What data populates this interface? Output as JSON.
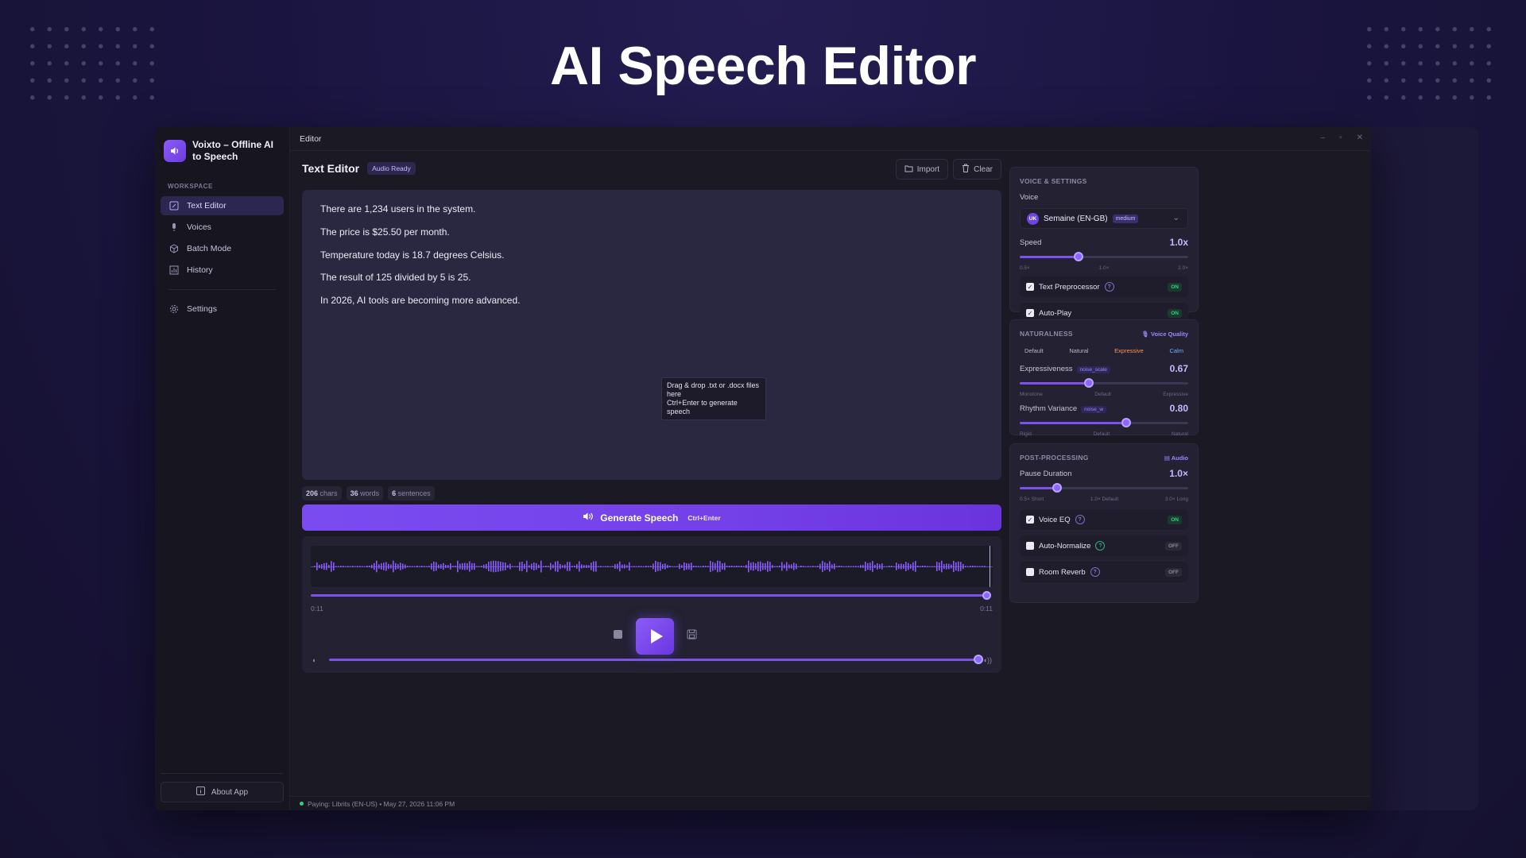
{
  "hero": {
    "title": "AI Speech Editor"
  },
  "app": {
    "name": "Voixto – Offline AI to Speech",
    "window_title": "Editor"
  },
  "sidebar": {
    "section_label": "WORKSPACE",
    "items": [
      {
        "label": "Text Editor",
        "icon": "edit-icon",
        "active": true
      },
      {
        "label": "Voices",
        "icon": "microphone-icon"
      },
      {
        "label": "Batch Mode",
        "icon": "cube-icon"
      },
      {
        "label": "History",
        "icon": "chart-icon"
      },
      {
        "label": "Settings",
        "icon": "gear-icon"
      }
    ],
    "about_label": "About App"
  },
  "editor": {
    "title": "Text Editor",
    "status_badge": "Audio Ready",
    "import_label": "Import",
    "clear_label": "Clear",
    "lines": [
      "There are 1,234 users in the system.",
      "The price is $25.50 per month.",
      "Temperature today is 18.7 degrees Celsius.",
      "The result of 125 divided by 5 is 25.",
      "In 2026, AI tools are becoming more advanced."
    ],
    "tooltip_line1": "Drag & drop .txt or .docx files here",
    "tooltip_line2": "Ctrl+Enter to generate speech",
    "stats": {
      "chars_value": "206",
      "chars_label": "chars",
      "words_value": "36",
      "words_label": "words",
      "sentences_value": "6",
      "sentences_label": "sentences"
    },
    "generate_label": "Generate Speech",
    "generate_shortcut": "Ctrl+Enter"
  },
  "player": {
    "time_current": "0:11",
    "time_total": "0:11",
    "progress": 1.0,
    "volume": 0.99
  },
  "status_bar": {
    "text": "Paying: Librits (EN-US) • May 27, 2026  11:06 PM"
  },
  "voice_settings": {
    "header": "VOICE & SETTINGS",
    "voice_label": "Voice",
    "voice_avatar": "UK",
    "voice_name": "Semaine (EN-GB)",
    "voice_quality": "medium",
    "speed_label": "Speed",
    "speed_value": "1.0x",
    "speed_fraction": 0.35,
    "speed_ticks": [
      "0.5×",
      "1.0×",
      "2.0×"
    ],
    "text_preprocessor_label": "Text Preprocessor",
    "text_preprocessor_state": "ON",
    "autoplay_label": "Auto-Play",
    "autoplay_state": "ON"
  },
  "naturalness": {
    "header": "NATURALNESS",
    "tag": "Voice Quality",
    "presets": [
      "Default",
      "Natural",
      "Expressive",
      "Calm"
    ],
    "expressiveness_label": "Expressiveness",
    "expressiveness_tag": "noise_scale",
    "expressiveness_value": "0.67",
    "expressiveness_fraction": 0.41,
    "expressiveness_ticks": [
      "Monotone",
      "Default",
      "Expressive"
    ],
    "rhythm_label": "Rhythm Variance",
    "rhythm_tag": "noise_w",
    "rhythm_value": "0.80",
    "rhythm_fraction": 0.63,
    "rhythm_ticks": [
      "Rigid",
      "Default",
      "Natural"
    ]
  },
  "post_processing": {
    "header": "POST-PROCESSING",
    "tag": "Audio",
    "pause_label": "Pause Duration",
    "pause_value": "1.0×",
    "pause_fraction": 0.22,
    "pause_ticks": [
      "0.5× Short",
      "1.0× Default",
      "3.0× Long"
    ],
    "voice_eq_label": "Voice EQ",
    "voice_eq_state": "ON",
    "auto_normalize_label": "Auto-Normalize",
    "auto_normalize_state": "OFF",
    "room_reverb_label": "Room Reverb",
    "room_reverb_state": "OFF"
  }
}
